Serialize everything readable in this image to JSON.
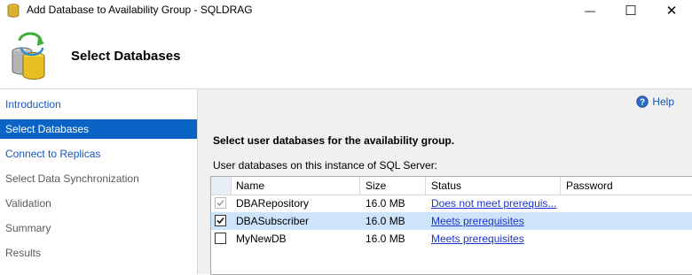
{
  "window": {
    "title": "Add Database to Availability Group - SQLDRAG",
    "minimize_symbol": "—",
    "maximize_symbol": "☐",
    "close_symbol": "✕"
  },
  "header": {
    "title": "Select Databases",
    "icon": "database-sync-icon"
  },
  "sidebar": {
    "items": [
      {
        "label": "Introduction",
        "state": "link"
      },
      {
        "label": "Select Databases",
        "state": "active"
      },
      {
        "label": "Connect to Replicas",
        "state": "link"
      },
      {
        "label": "Select Data Synchronization",
        "state": "disabled"
      },
      {
        "label": "Validation",
        "state": "disabled"
      },
      {
        "label": "Summary",
        "state": "disabled"
      },
      {
        "label": "Results",
        "state": "disabled"
      }
    ]
  },
  "main": {
    "help_label": "Help",
    "heading": "Select user databases for the availability group.",
    "grid_caption": "User databases on this instance of SQL Server:",
    "columns": [
      "Name",
      "Size",
      "Status",
      "Password"
    ],
    "rows": [
      {
        "checked": true,
        "enabled": false,
        "selected": false,
        "name": "DBARepository",
        "size": "16.0 MB",
        "status": "Does not meet prerequis...",
        "password": ""
      },
      {
        "checked": true,
        "enabled": true,
        "selected": true,
        "name": "DBASubscriber",
        "size": "16.0 MB",
        "status": "Meets prerequisites",
        "password": ""
      },
      {
        "checked": false,
        "enabled": true,
        "selected": false,
        "name": "MyNewDB",
        "size": "16.0 MB",
        "status": "Meets prerequisites",
        "password": ""
      }
    ]
  },
  "colors": {
    "active_nav_bg": "#0a64c5",
    "link": "#1a56b5",
    "selected_row_bg": "#cde4fb",
    "panel_bg": "#f0f0f0"
  }
}
